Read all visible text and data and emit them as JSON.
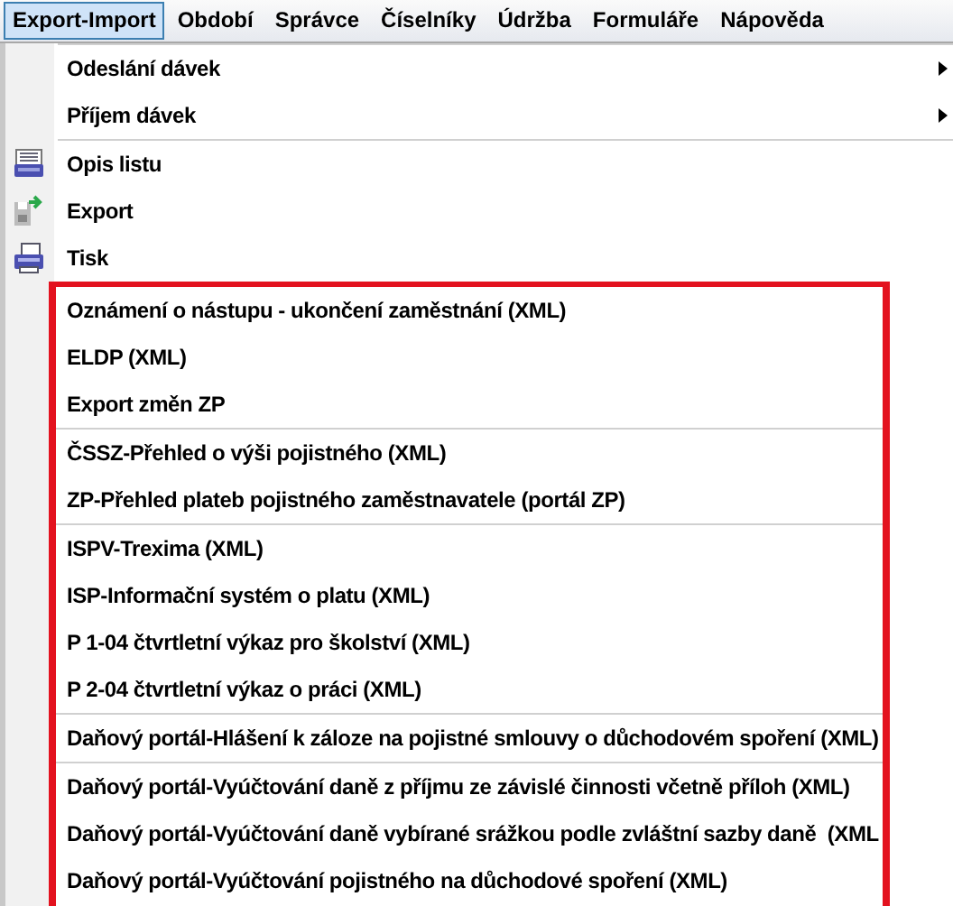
{
  "menubar": [
    {
      "label": "Export-Import",
      "selected": true
    },
    {
      "label": "Období",
      "selected": false
    },
    {
      "label": "Správce",
      "selected": false
    },
    {
      "label": "Číselníky",
      "selected": false
    },
    {
      "label": "Údržba",
      "selected": false
    },
    {
      "label": "Formuláře",
      "selected": false
    },
    {
      "label": "Nápověda",
      "selected": false
    }
  ],
  "menu": {
    "groups": [
      {
        "items": [
          {
            "label": "Odeslání dávek",
            "kind": "submenu"
          },
          {
            "label": "Příjem dávek",
            "kind": "submenu"
          }
        ]
      },
      {
        "items": [
          {
            "label": "Opis listu",
            "kind": "listing"
          },
          {
            "label": "Export",
            "kind": "export"
          },
          {
            "label": "Tisk",
            "kind": "print"
          }
        ]
      }
    ],
    "highlight": {
      "groups": [
        {
          "items": [
            {
              "label": "Oznámení o nástupu - ukončení zaměstnání (XML)"
            },
            {
              "label": "ELDP (XML)"
            },
            {
              "label": "Export změn ZP"
            }
          ]
        },
        {
          "items": [
            {
              "label": "ČSSZ-Přehled o výši pojistného (XML)"
            },
            {
              "label": "ZP-Přehled plateb pojistného zaměstnavatele (portál ZP)"
            }
          ]
        },
        {
          "items": [
            {
              "label": "ISPV-Trexima (XML)"
            },
            {
              "label": "ISP-Informační systém o platu (XML)"
            },
            {
              "label": "P 1-04 čtvrtletní výkaz pro školství (XML)"
            },
            {
              "label": "P 2-04 čtvrtletní výkaz o práci (XML)"
            }
          ]
        },
        {
          "items": [
            {
              "label": "Daňový portál-Hlášení k záloze na pojistné smlouvy o důchodovém spoření (XML)"
            }
          ]
        },
        {
          "items": [
            {
              "label": "Daňový portál-Vyúčtování daně z příjmu ze závislé činnosti včetně příloh (XML)"
            },
            {
              "label": "Daňový portál-Vyúčtování daně vybírané srážkou podle zvláštní sazby daně  (XML"
            },
            {
              "label": "Daňový portál-Vyúčtování pojistného na důchodové spoření (XML)"
            }
          ]
        }
      ]
    }
  }
}
